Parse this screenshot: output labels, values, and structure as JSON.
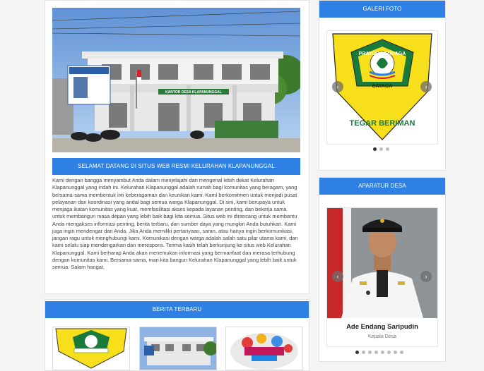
{
  "main": {
    "building_sign": "KANTOR DESA KLAPANUNGGAL",
    "welcome_title": "SELAMAT DATANG DI SITUS WEB RESMI KELURAHAN KLAPANUNGGAL",
    "welcome_body": "Kami dengan bangga menyambut Anda dalam menjelajahi dan mengenal lebih dekat Kelurahan Klapanunggal yang indah ini. Kelurahan Klapanunggal adalah rumah bagi komunitas yang beragam, yang bersama-sama membentuk inti keberagaman dan keunikan kami. Kami berkomitmen untuk menjadi pusat pelayanan dan koordinasi yang andal bagi semua warga Klapanunggal. Di sini, kami berupaya untuk menjaga ikatan komunitas yang kuat, memfasilitasi akses kepada layanan penting, dan bekerja sama untuk membangun masa depan yang lebih baik bagi kita semua. Situs web ini dirancang untuk membantu Anda mengakses informasi penting, berita terbaru, dan sumber daya yang mungkin Anda butuhkan. Kami juga ingin mendengar dari Anda. Jika Anda memiliki pertanyaan, saran, atau hanya ingin berkomunikasi, jangan ragu untuk menghubungi kami. Komunikasi dengan warga adalah salah satu pilar utama kami, dan kami selalu siap mendengarkan dan merespons. Terima kasih telah berkunjung ke situs web Kelurahan Klapanunggal. Kami berharap Anda akan menemukan informasi yang bermanfaat dan merasa terhubung dengan komunitas kami. Bersama-sama, mari kita bangun Kelurahan Klapanunggal yang lebih baik untuk semua. Salam hangat,"
  },
  "news": {
    "title": "BERITA TERBARU"
  },
  "gallery": {
    "title": "GALERI FOTO",
    "emblem_top": "PRAYOGA TOHAGA",
    "emblem_mid": "SAYAGA",
    "emblem_bottom": "TEGAR BERIMAN",
    "prev_icon": "‹",
    "next_icon": "›"
  },
  "aparatur": {
    "title": "APARATUR DESA",
    "name": "Ade Endang Saripudin",
    "role": "Kepala Desa",
    "prev_icon": "‹",
    "next_icon": "›"
  },
  "colors": {
    "accent": "#2f80e4",
    "emblem_yellow": "#f7df1c",
    "emblem_green": "#1a7a3c"
  }
}
